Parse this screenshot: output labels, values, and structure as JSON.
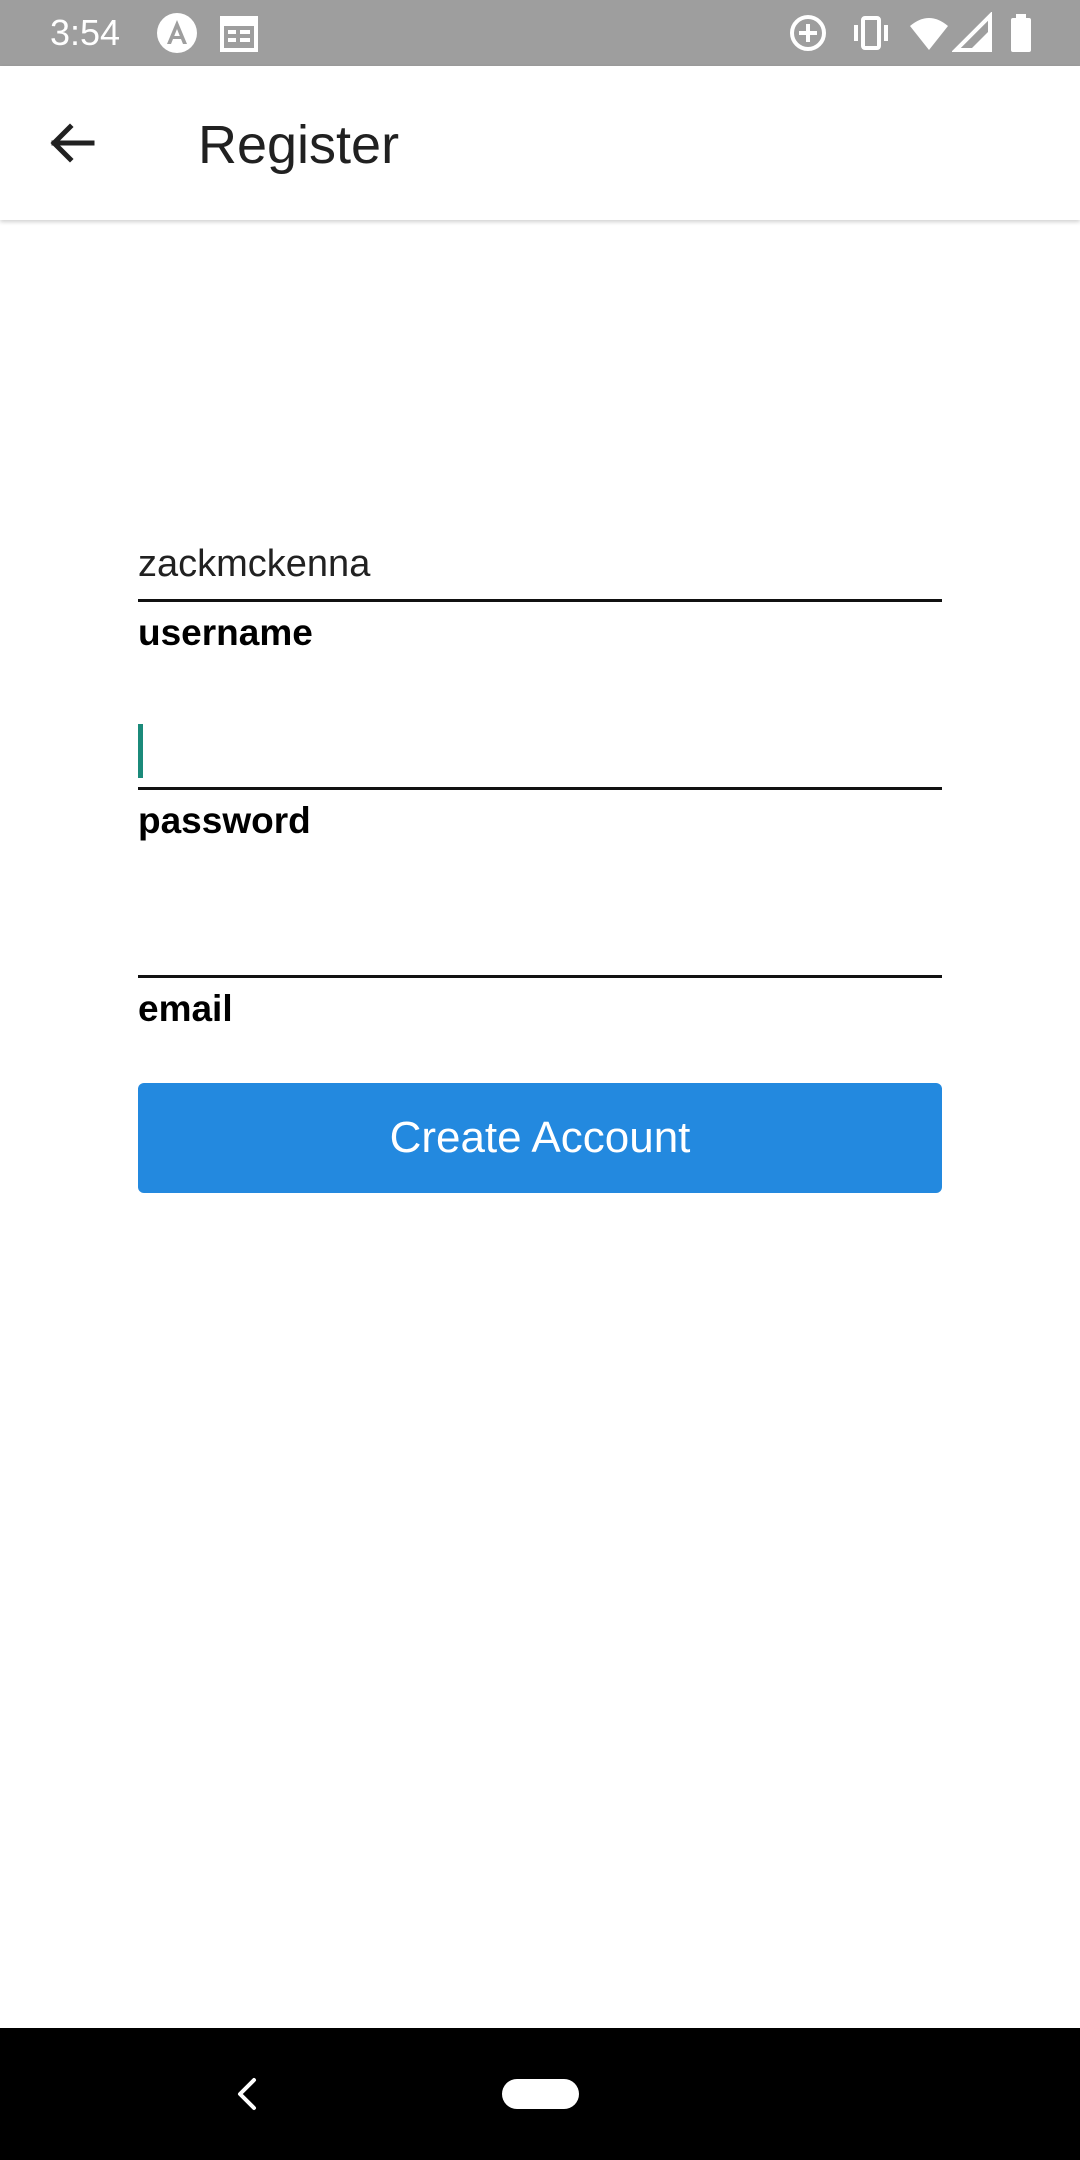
{
  "status_bar": {
    "time": "3:54",
    "left_icons": [
      "angular-icon",
      "calendar-icon"
    ],
    "right_icons": [
      "data-saver-icon",
      "vibrate-icon",
      "wifi-icon",
      "signal-icon",
      "battery-icon"
    ]
  },
  "app_bar": {
    "title": "Register",
    "back_icon": "arrow-left-icon"
  },
  "form": {
    "username": {
      "value": "zackmckenna",
      "label": "username"
    },
    "password": {
      "value": "",
      "label": "password",
      "focused": true
    },
    "email": {
      "value": "",
      "label": "email"
    },
    "submit_label": "Create Account"
  },
  "colors": {
    "status_bar": "#9e9e9e",
    "accent": "#2389df",
    "cursor": "#1b8a7a",
    "nav_bar": "#000000"
  },
  "nav_bar": {
    "icons": [
      "nav-back-icon",
      "home-pill-icon"
    ]
  }
}
